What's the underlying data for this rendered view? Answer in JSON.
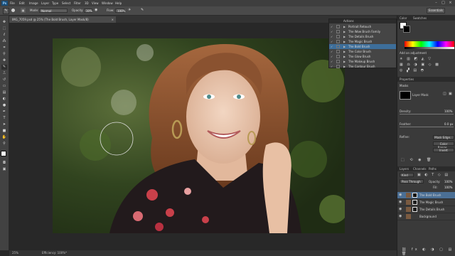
{
  "app": {
    "logo": "Ps"
  },
  "menu": [
    "File",
    "Edit",
    "Image",
    "Layer",
    "Type",
    "Select",
    "Filter",
    "3D",
    "View",
    "Window",
    "Help"
  ],
  "options": {
    "mode_label": "Mode:",
    "mode_value": "Normal",
    "opacity_label": "Opacity:",
    "opacity_value": "30%",
    "flow_label": "Flow:",
    "flow_value": "100%",
    "workspace": "Essentials"
  },
  "document": {
    "tab_title": "IMG_7059.psd @ 25% (The Bold Brush, Layer Mask/8)",
    "zoom": "25%",
    "status": "Efficiency: 100%*"
  },
  "actions_panel": {
    "title": "Actions",
    "items": [
      {
        "name": "Portrait Retouch",
        "selected": false
      },
      {
        "name": "The Wow Brush Family",
        "selected": false
      },
      {
        "name": "The Details Brush",
        "selected": false
      },
      {
        "name": "The Magic Brush",
        "selected": false
      },
      {
        "name": "The Bold Brush",
        "selected": true
      },
      {
        "name": "The Color Brush",
        "selected": false
      },
      {
        "name": "The Glow Brush",
        "selected": false
      },
      {
        "name": "The Makeup Brush",
        "selected": false
      },
      {
        "name": "The Contour Brush",
        "selected": false
      }
    ]
  },
  "color_panel": {
    "tab1": "Color",
    "tab2": "Swatches"
  },
  "adjustments": {
    "title": "Add an adjustment"
  },
  "properties": {
    "title": "Properties",
    "subtitle": "Masks",
    "mask_label": "Layer Mask",
    "density_label": "Density:",
    "density_value": "100%",
    "feather_label": "Feather:",
    "feather_value": "0.0 px",
    "refine_label": "Refine:",
    "btn_mask_edge": "Mask Edge...",
    "btn_color_range": "Color Range...",
    "btn_invert": "Invert"
  },
  "layers_panel": {
    "tabs": [
      "Layers",
      "Channels",
      "Paths"
    ],
    "kind": "Kind",
    "blend": "Pass Through",
    "opacity_label": "Opacity:",
    "opacity_value": "100%",
    "fill_label": "Fill:",
    "fill_value": "100%",
    "layers": [
      {
        "name": "The Bold Brush",
        "selected": true,
        "thumb": "#111111"
      },
      {
        "name": "The Magic Brush",
        "selected": false,
        "thumb": "#1c1c1c"
      },
      {
        "name": "The Details Brush",
        "selected": false,
        "thumb": "#1a1a1a"
      },
      {
        "name": "Background",
        "selected": false,
        "thumb": "#7a5a40"
      }
    ]
  },
  "colors": {
    "accent": "#3d6e9a",
    "ui_dark": "#282828",
    "panel": "#3a3a3a"
  }
}
